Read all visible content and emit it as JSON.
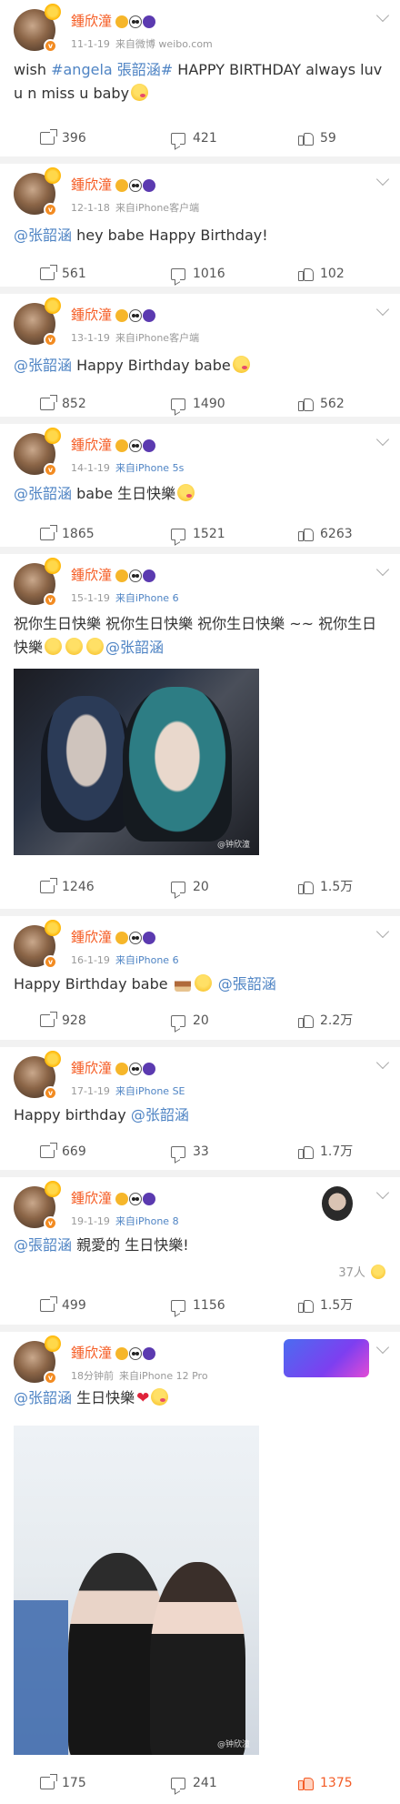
{
  "user": {
    "name": "鍾欣潼"
  },
  "posts": [
    {
      "date": "11-1-19",
      "source": "来自微博 weibo.com",
      "source_blue": false,
      "text_parts": [
        "wish ",
        "#angela 張韶涵#",
        " HAPPY BIRTHDAY  always luv u n miss u baby"
      ],
      "share": "396",
      "comment": "421",
      "like": "59"
    },
    {
      "date": "12-1-18",
      "source": "来自iPhone客户端",
      "source_blue": false,
      "mention": "@张韶涵",
      "text": " hey babe Happy Birthday!",
      "share": "561",
      "comment": "1016",
      "like": "102"
    },
    {
      "date": "13-1-19",
      "source": "来自iPhone客户端",
      "source_blue": false,
      "mention": "@张韶涵",
      "text": " Happy Birthday babe",
      "share": "852",
      "comment": "1490",
      "like": "562"
    },
    {
      "date": "14-1-19",
      "source": "来自iPhone 5s",
      "source_blue": true,
      "mention": "@张韶涵",
      "text": " babe 生日快樂",
      "share": "1865",
      "comment": "1521",
      "like": "6263"
    },
    {
      "date": "15-1-19",
      "source": "来自iPhone 6",
      "source_blue": true,
      "text": "祝你生日快樂 祝你生日快樂 祝你生日快樂 ~~ 祝你生日快樂",
      "mention": "@张韶涵",
      "photo_watermark": "@钟欣潼",
      "share": "1246",
      "comment": "20",
      "like": "1.5万"
    },
    {
      "date": "16-1-19",
      "source": "来自iPhone 6",
      "source_blue": true,
      "text": "Happy Birthday babe ",
      "mention": "@張韶涵",
      "share": "928",
      "comment": "20",
      "like": "2.2万"
    },
    {
      "date": "17-1-19",
      "source": "来自iPhone SE",
      "source_blue": true,
      "text": "Happy birthday ",
      "mention": "@张韶涵",
      "share": "669",
      "comment": "33",
      "like": "1.7万"
    },
    {
      "date": "19-1-19",
      "source": "来自iPhone 8",
      "source_blue": true,
      "mention": "@張韶涵",
      "text": " 親愛的 生日快樂!",
      "reaction": "37人",
      "share": "499",
      "comment": "1156",
      "like": "1.5万"
    },
    {
      "date": "18分钟前",
      "source": "来自iPhone 12 Pro",
      "source_blue": false,
      "mention": "@张韶涵",
      "text": " 生日快樂",
      "photo_watermark": "@钟欣潼",
      "share": "175",
      "comment": "241",
      "like": "1375"
    }
  ]
}
